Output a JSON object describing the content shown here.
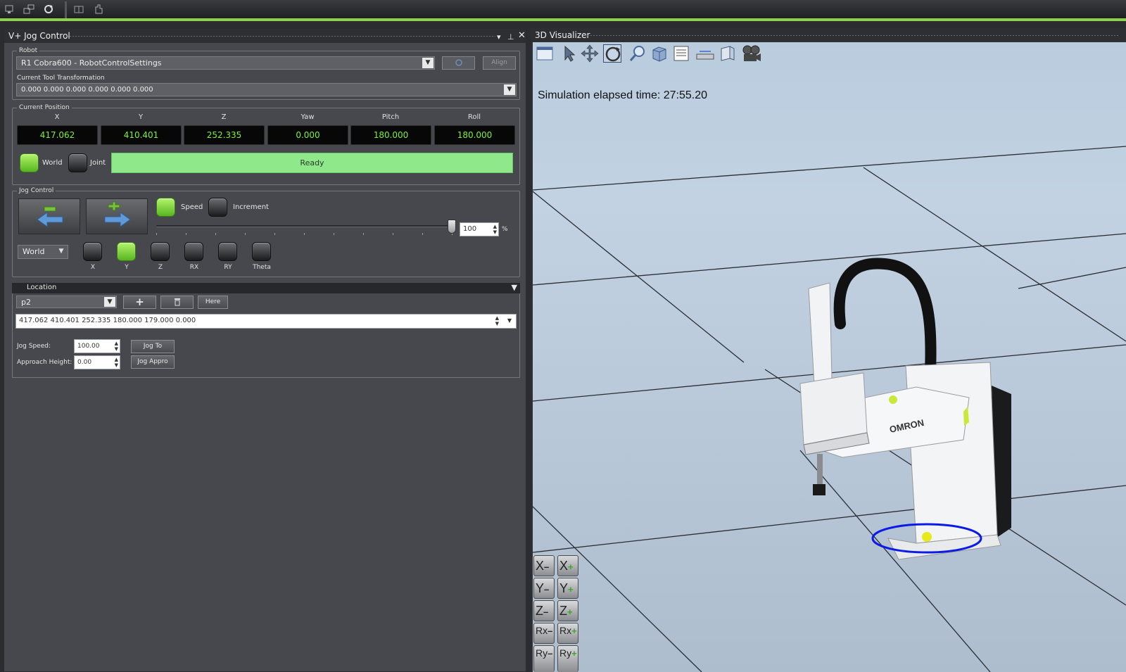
{
  "toolbar": {
    "icons": [
      "workspace-icon",
      "network-icon",
      "refresh-icon",
      "grid-icon",
      "hand-icon"
    ]
  },
  "jog_panel": {
    "title": "V+ Jog Control",
    "robot": {
      "legend": "Robot",
      "selected": "R1 Cobra600  -  RobotControlSettings",
      "align_label": "Align",
      "tool_label": "Current Tool Transformation",
      "tool_value": "0.000 0.000 0.000 0.000 0.000 0.000"
    },
    "position": {
      "legend": "Current Position",
      "headers": [
        "X",
        "Y",
        "Z",
        "Yaw",
        "Pitch",
        "Roll"
      ],
      "values": [
        "417.062",
        "410.401",
        "252.335",
        "0.000",
        "180.000",
        "180.000"
      ],
      "world_label": "World",
      "joint_label": "Joint",
      "status": "Ready"
    },
    "jog": {
      "legend": "Jog Control",
      "speed_label": "Speed",
      "increment_label": "Increment",
      "speed_value": "100",
      "speed_unit": "%",
      "speed_fraction": 1.0,
      "frame": "World",
      "axes": [
        "X",
        "Y",
        "Z",
        "RX",
        "RY",
        "Theta"
      ],
      "active_axis": "Y"
    },
    "location": {
      "legend": "Location",
      "selected": "p2",
      "here_label": "Here",
      "value": "417.062 410.401 252.335 180.000 179.000 0.000",
      "jog_speed_label": "Jog Speed:",
      "jog_speed_value": "100.00",
      "approach_label": "Approach Height:",
      "approach_value": "0.00",
      "jog_to_label": "Jog To",
      "jog_appro_label": "Jog Appro"
    }
  },
  "visualizer": {
    "title": "3D Visualizer",
    "sim_time": "Simulation elapsed time: 27:55.20",
    "robot_brand": "OMRON",
    "axis_buttons": [
      {
        "minus": "X",
        "plus": "X"
      },
      {
        "minus": "Y",
        "plus": "Y"
      },
      {
        "minus": "Z",
        "plus": "Z"
      },
      {
        "minus": "Rx",
        "plus": "Rx"
      },
      {
        "minus": "Ry",
        "plus": "Ry"
      }
    ],
    "colors": {
      "sky": "#b9ccde",
      "accent_green": "#8fd14f",
      "led_green": "#7ef22e"
    }
  }
}
